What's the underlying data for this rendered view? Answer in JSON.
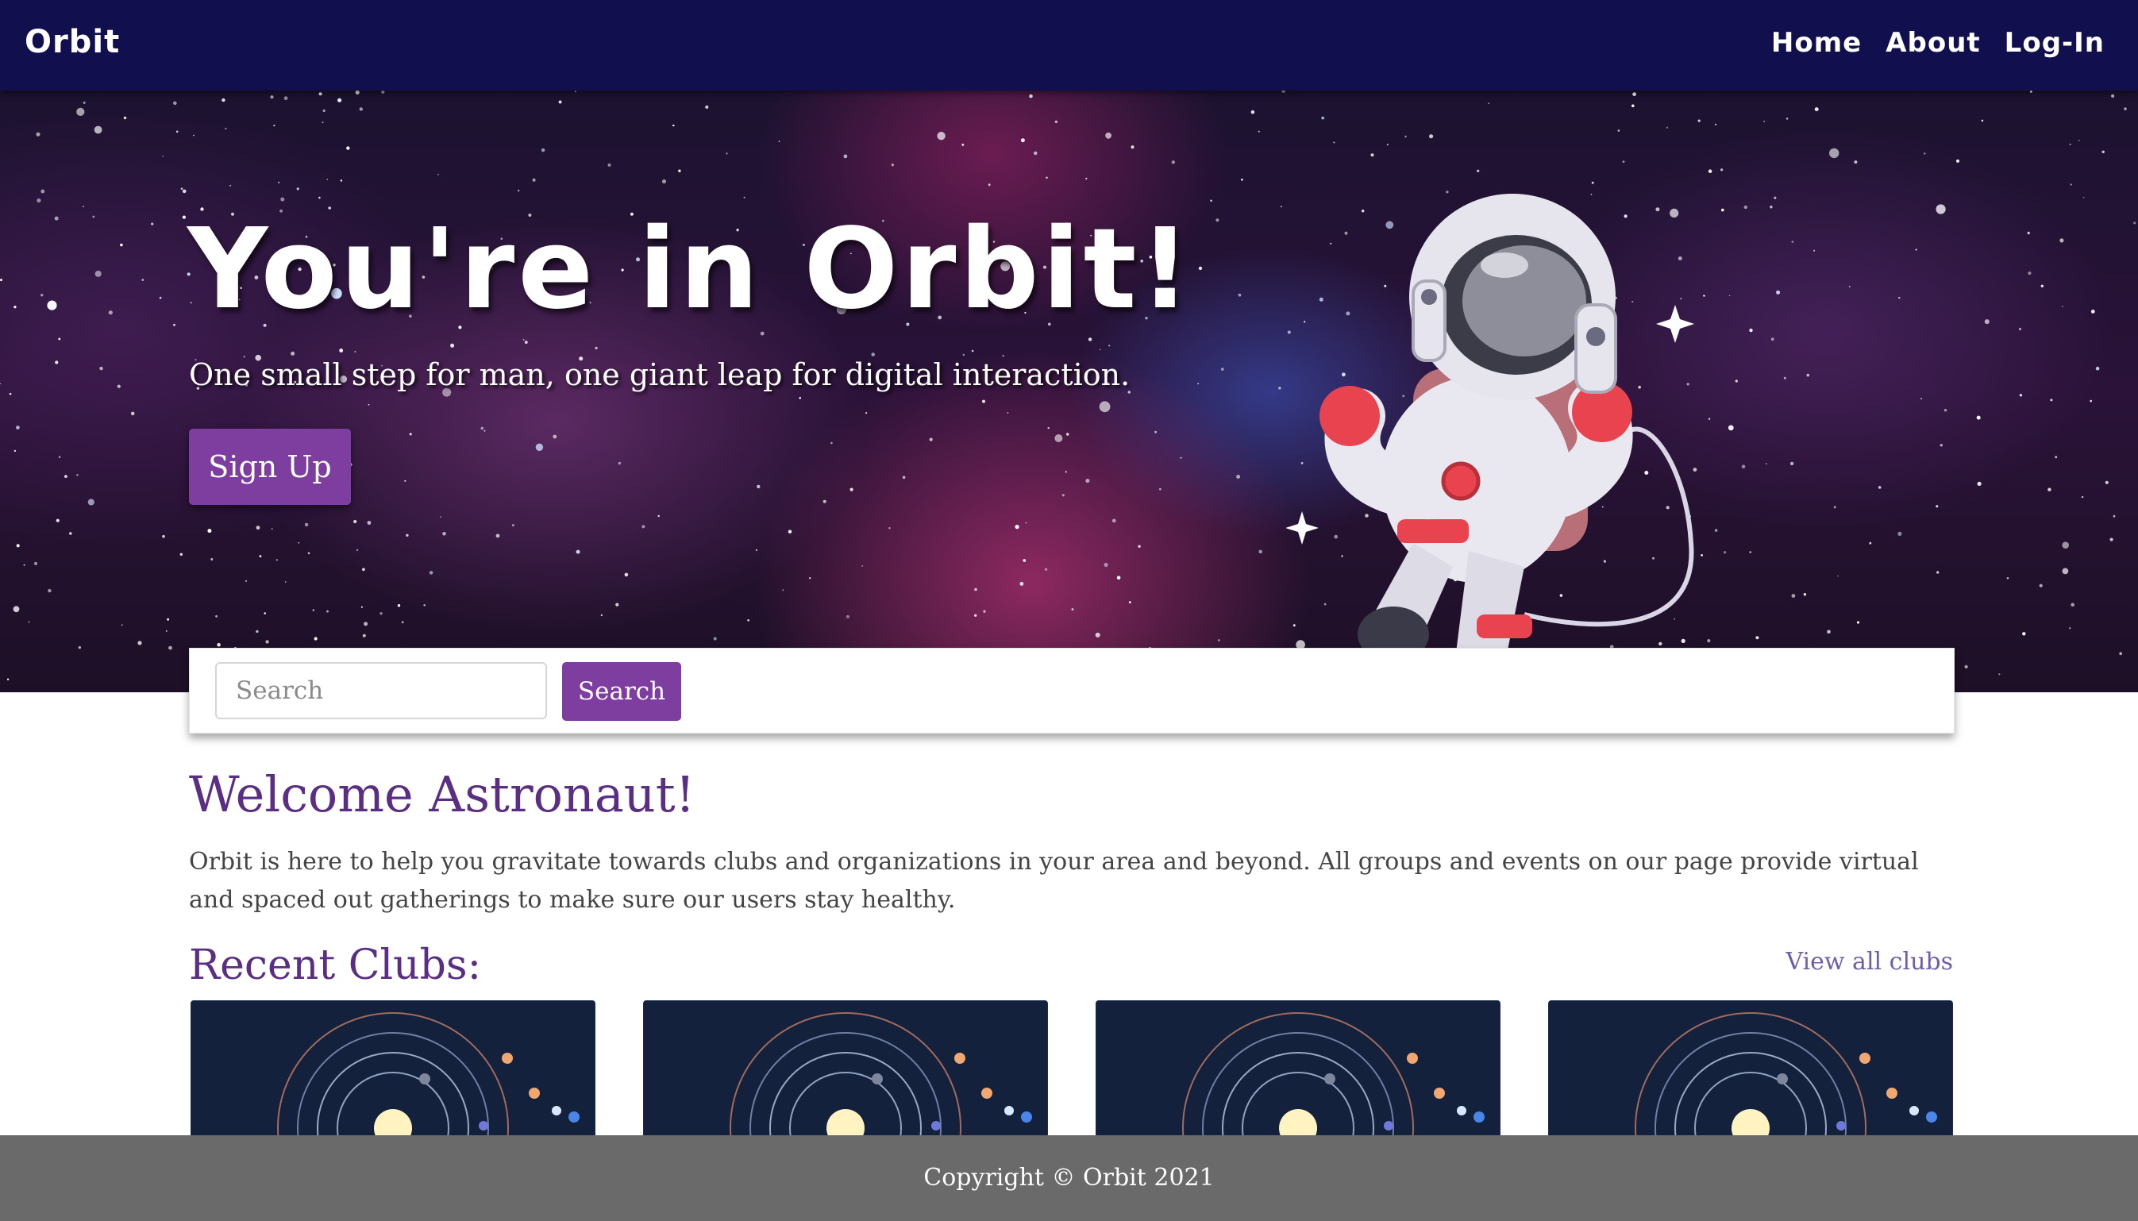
{
  "nav": {
    "brand": "Orbit",
    "links": [
      "Home",
      "About",
      "Log-In"
    ]
  },
  "hero": {
    "title": "You're in Orbit!",
    "subtitle": "One small step for man, one giant leap for digital interaction.",
    "signup_label": "Sign Up"
  },
  "search": {
    "placeholder": "Search",
    "button_label": "Search"
  },
  "welcome": {
    "heading": "Welcome Astronaut!",
    "text": "Orbit is here to help you gravitate towards clubs and organizations in your area and beyond. All groups and events on our page provide virtual and spaced out gatherings to make sure our users stay healthy."
  },
  "recent_clubs": {
    "heading": "Recent Clubs:",
    "view_all": "View all clubs",
    "cards": 4
  },
  "footer": {
    "copyright": "Copyright © Orbit 2021"
  },
  "colors": {
    "navbar": "#120f4e",
    "accent": "#7d3ea0",
    "heading": "#5a2e82",
    "footer": "#6a6a6a",
    "card": "#14213d"
  }
}
